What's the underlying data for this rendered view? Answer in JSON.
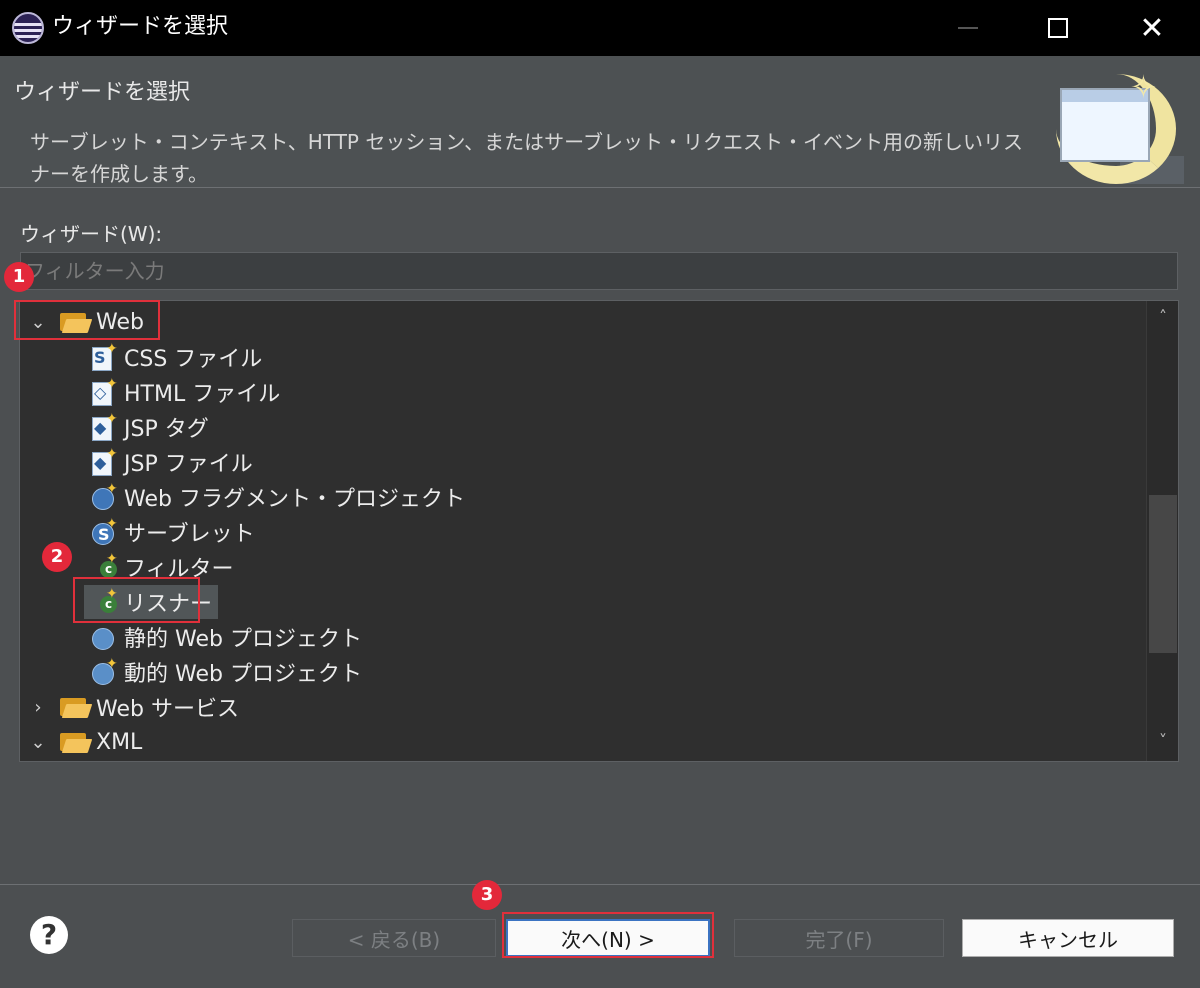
{
  "window": {
    "title": "ウィザードを選択",
    "minimize_icon": "minimize-icon",
    "maximize_icon": "maximize-icon",
    "close_glyph": "✕"
  },
  "header": {
    "title": "ウィザードを選択",
    "description": "サーブレット・コンテキスト、HTTP セッション、またはサーブレット・リクエスト・イベント用の新しいリスナーを作成します。"
  },
  "wizard_label": "ウィザード(W):",
  "filter": {
    "placeholder": "フィルター入力",
    "value": ""
  },
  "tree": {
    "items": [
      {
        "label": "Web",
        "type": "folder",
        "expanded": true,
        "level": 0
      },
      {
        "label": "CSS ファイル",
        "type": "css-file",
        "level": 1
      },
      {
        "label": "HTML ファイル",
        "type": "html-file",
        "level": 1
      },
      {
        "label": "JSP タグ",
        "type": "jsp-tag",
        "level": 1
      },
      {
        "label": "JSP ファイル",
        "type": "jsp-file",
        "level": 1
      },
      {
        "label": "Web フラグメント・プロジェクト",
        "type": "web-fragment-project",
        "level": 1
      },
      {
        "label": "サーブレット",
        "type": "servlet",
        "level": 1
      },
      {
        "label": "フィルター",
        "type": "filter",
        "level": 1
      },
      {
        "label": "リスナー",
        "type": "listener",
        "level": 1,
        "selected": true
      },
      {
        "label": "静的 Web プロジェクト",
        "type": "static-web-project",
        "level": 1
      },
      {
        "label": "動的 Web プロジェクト",
        "type": "dynamic-web-project",
        "level": 1
      },
      {
        "label": "Web サービス",
        "type": "folder",
        "expanded": false,
        "level": 0
      },
      {
        "label": "XML",
        "type": "folder",
        "expanded": true,
        "level": 0
      }
    ]
  },
  "buttons": {
    "back": "< 戻る(B)",
    "next": "次へ(N) >",
    "finish": "完了(F)",
    "cancel": "キャンセル",
    "help": "?"
  },
  "annotations": {
    "badge1": "1",
    "badge2": "2",
    "badge3": "3"
  },
  "colors": {
    "accent": "#e3283a",
    "focus": "#3b73c2",
    "folder": "#f4c45c"
  }
}
